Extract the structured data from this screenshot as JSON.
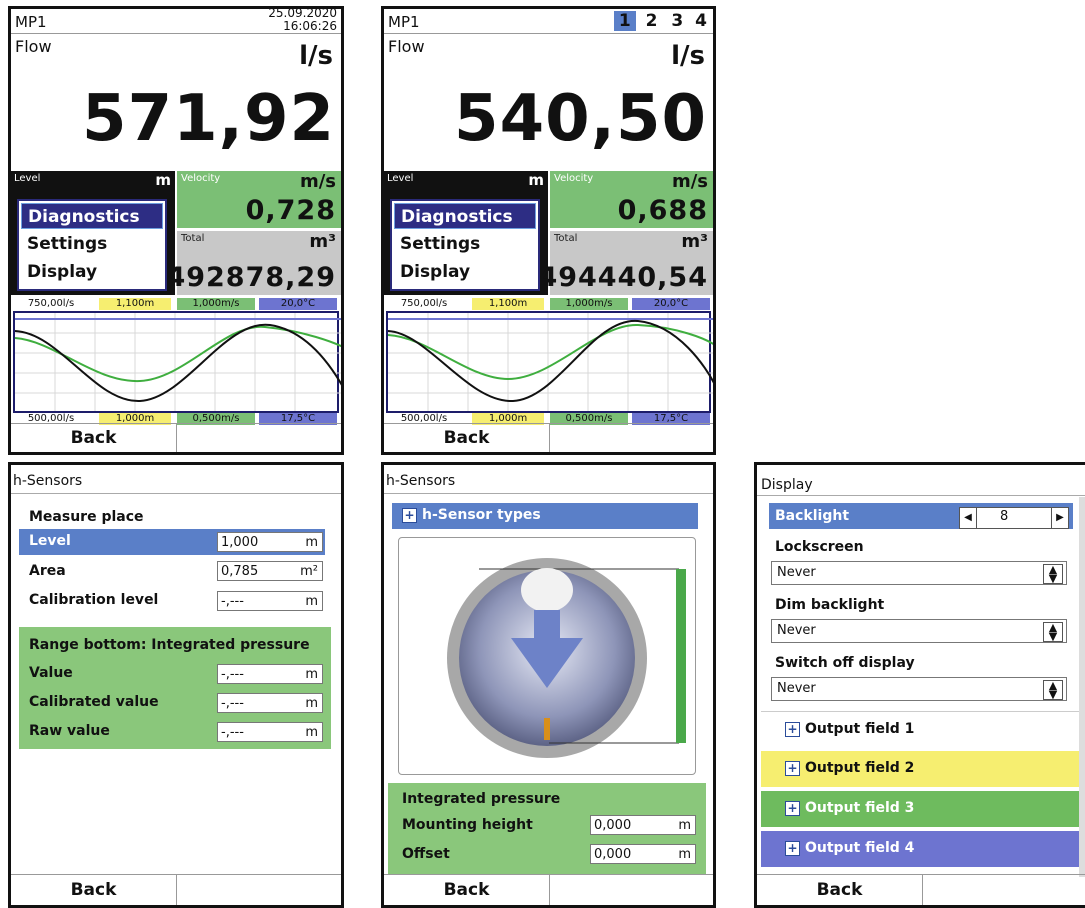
{
  "screen1": {
    "mp": "MP1",
    "date": "25.09.2020",
    "time": "16:06:26",
    "flow_label": "Flow",
    "flow_unit": "l/s",
    "flow_value": "571,92",
    "level_label": "Level",
    "level_unit": "m",
    "velocity_label": "Velocity",
    "velocity_unit": "m/s",
    "velocity_value": "0,728",
    "total_label": "Total",
    "total_unit": "m³",
    "total_value": "492878,29",
    "menu": [
      "Diagnostics",
      "Settings",
      "Display"
    ],
    "scale_top": [
      "750,00l/s",
      "1,100m",
      "1,000m/s",
      "20,0°C"
    ],
    "scale_bottom": [
      "500,00l/s",
      "1,000m",
      "0,500m/s",
      "17,5°C"
    ],
    "back": "Back"
  },
  "screen2": {
    "mp": "MP1",
    "pages": [
      "1",
      "2",
      "3",
      "4"
    ],
    "flow_label": "Flow",
    "flow_unit": "l/s",
    "flow_value": "540,50",
    "level_label": "Level",
    "level_unit": "m",
    "velocity_label": "Velocity",
    "velocity_unit": "m/s",
    "velocity_value": "0,688",
    "total_label": "Total",
    "total_unit": "m³",
    "total_value": "494440,54",
    "menu": [
      "Diagnostics",
      "Settings",
      "Display"
    ],
    "scale_top": [
      "750,00l/s",
      "1,100m",
      "1,000m/s",
      "20,0°C"
    ],
    "scale_bottom": [
      "500,00l/s",
      "1,000m",
      "0,500m/s",
      "17,5°C"
    ],
    "back": "Back"
  },
  "screen3": {
    "title": "h-Sensors",
    "measure_place": "Measure place",
    "level_label": "Level",
    "level_value": "1,000",
    "level_unit": "m",
    "area_label": "Area",
    "area_value": "0,785",
    "area_unit": "m²",
    "cal_label": "Calibration level",
    "cal_value": "-,---",
    "cal_unit": "m",
    "range_title": "Range bottom: Integrated pressure",
    "value_label": "Value",
    "value_value": "-,---",
    "value_unit": "m",
    "calval_label": "Calibrated value",
    "calval_value": "-,---",
    "calval_unit": "m",
    "raw_label": "Raw value",
    "raw_value": "-,---",
    "raw_unit": "m",
    "back": "Back"
  },
  "screen4": {
    "title": "h-Sensors",
    "sensor_types": "h-Sensor types",
    "integrated": "Integrated pressure",
    "mount_label": "Mounting height",
    "mount_value": "0,000",
    "mount_unit": "m",
    "offset_label": "Offset",
    "offset_value": "0,000",
    "offset_unit": "m",
    "back": "Back"
  },
  "screen5": {
    "title": "Display",
    "backlight_label": "Backlight",
    "backlight_value": "8",
    "lockscreen_label": "Lockscreen",
    "lockscreen_value": "Never",
    "dim_label": "Dim backlight",
    "dim_value": "Never",
    "switch_label": "Switch off display",
    "switch_value": "Never",
    "output_fields": [
      "Output field 1",
      "Output field 2",
      "Output field 3",
      "Output field 4"
    ],
    "back": "Back"
  },
  "colors": {
    "green": "#7bbf75",
    "yellow": "#f6ee70",
    "blue": "#6d74d0",
    "selection": "#2d2d84"
  }
}
